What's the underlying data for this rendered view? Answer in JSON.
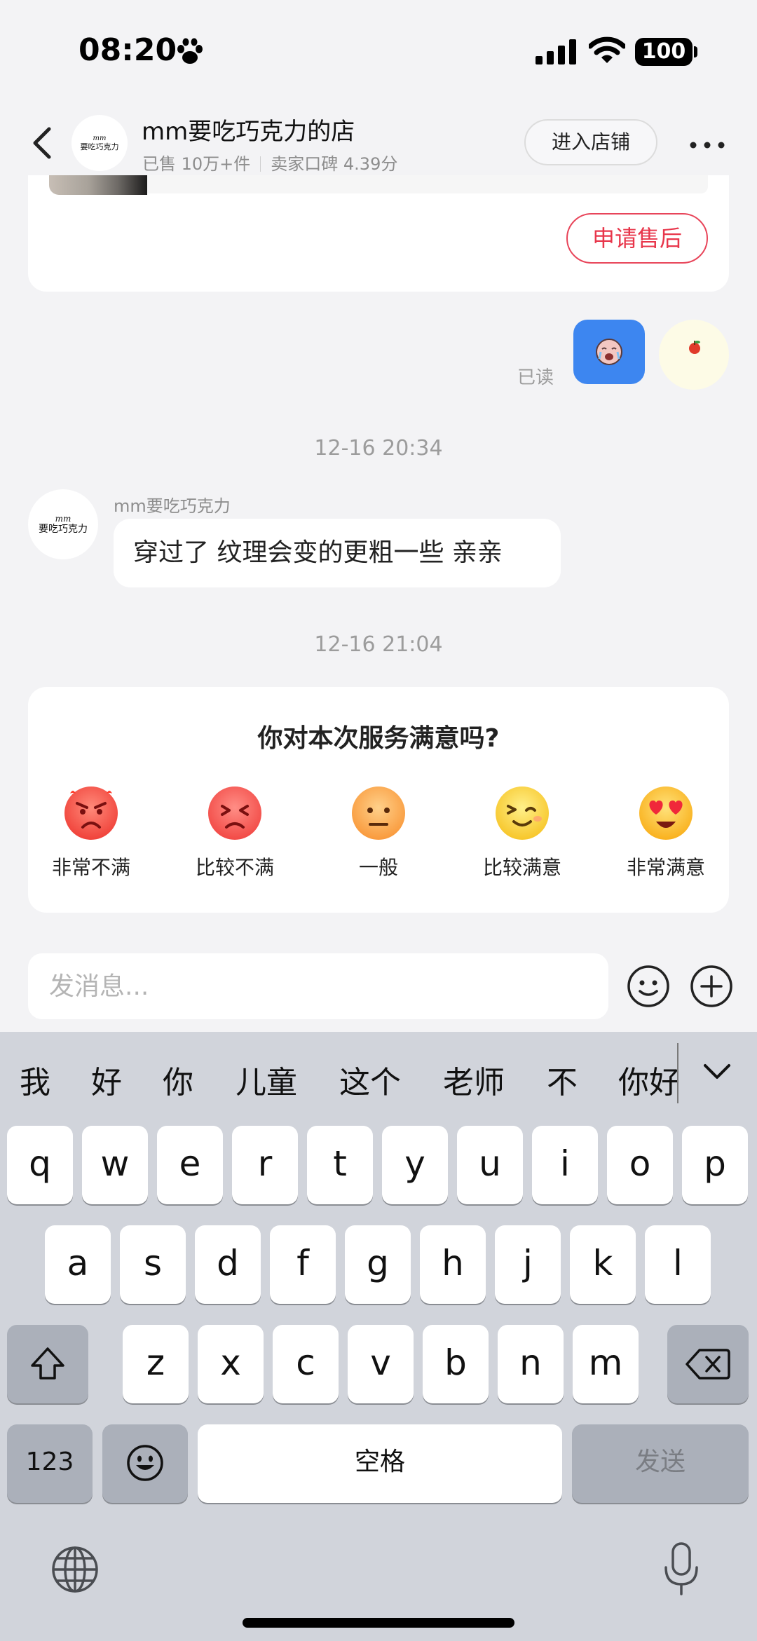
{
  "status_bar": {
    "time": "08:20",
    "battery": "100"
  },
  "header": {
    "shop_avatar": [
      "mm",
      "要吃巧克力"
    ],
    "shop_name": "mm要吃巧克力的店",
    "sold": "已售 10万+件",
    "rating": "卖家口碑 4.39分",
    "enter_shop": "进入店铺"
  },
  "order_card": {
    "after_sale_label": "申请售后"
  },
  "outgoing": {
    "read_label": "已读"
  },
  "timestamps": [
    "12-16 20:34",
    "12-16 21:04"
  ],
  "incoming": {
    "avatar": [
      "mm",
      "要吃巧克力"
    ],
    "sender": "mm要吃巧克力",
    "text": "穿过了 纹理会变的更粗一些 亲亲"
  },
  "survey": {
    "title": "你对本次服务满意吗?",
    "options": [
      {
        "label": "非常不满",
        "icon": "very-dissatisfied-face-icon"
      },
      {
        "label": "比较不满",
        "icon": "dissatisfied-face-icon"
      },
      {
        "label": "一般",
        "icon": "neutral-face-icon"
      },
      {
        "label": "比较满意",
        "icon": "satisfied-face-icon"
      },
      {
        "label": "非常满意",
        "icon": "very-satisfied-face-icon"
      }
    ]
  },
  "input": {
    "placeholder": "发消息..."
  },
  "keyboard": {
    "suggestions": [
      "我",
      "好",
      "你",
      "儿童",
      "这个",
      "老师",
      "不",
      "你好"
    ],
    "row1": [
      "q",
      "w",
      "e",
      "r",
      "t",
      "y",
      "u",
      "i",
      "o",
      "p"
    ],
    "row2": [
      "a",
      "s",
      "d",
      "f",
      "g",
      "h",
      "j",
      "k",
      "l"
    ],
    "row3": [
      "z",
      "x",
      "c",
      "v",
      "b",
      "n",
      "m"
    ],
    "numbers_key": "123",
    "space_key": "空格",
    "send_key": "发送"
  },
  "colors": {
    "accent_red": "#e8364b",
    "sticker_blue": "#3d86f0",
    "background": "#f3f3f5",
    "keyboard_bg": "#d1d4db"
  }
}
